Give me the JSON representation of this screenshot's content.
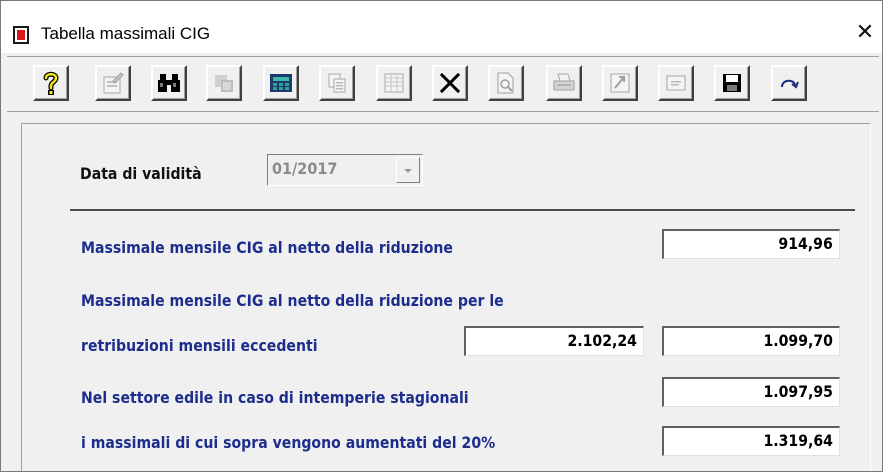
{
  "window": {
    "title": "Tabella massimali CIG",
    "close_glyph": "✕"
  },
  "toolbar": {
    "buttons": [
      {
        "icon": "help-icon",
        "enabled": true
      },
      {
        "icon": "properties-icon",
        "enabled": false
      },
      {
        "icon": "binoculars-icon",
        "enabled": true
      },
      {
        "icon": "copy-record-icon",
        "enabled": false
      },
      {
        "icon": "calculator-icon",
        "enabled": true
      },
      {
        "icon": "duplicate-icon",
        "enabled": false
      },
      {
        "icon": "grid-icon",
        "enabled": false
      },
      {
        "icon": "delete-icon",
        "enabled": true
      },
      {
        "icon": "preview-icon",
        "enabled": false
      },
      {
        "icon": "print-icon",
        "enabled": false
      },
      {
        "icon": "export-icon",
        "enabled": false
      },
      {
        "icon": "form-icon",
        "enabled": false
      },
      {
        "icon": "save-icon",
        "enabled": true
      },
      {
        "icon": "undo-icon",
        "enabled": true
      }
    ]
  },
  "form": {
    "validity_label": "Data di validità",
    "validity_value": "01/2017",
    "row1_label": "Massimale mensile CIG al netto della riduzione",
    "row1_value": "914,96",
    "row2_label_line1": "Massimale mensile CIG al netto della riduzione per le",
    "row2_label_line2": "retribuzioni mensili eccedenti",
    "row2_threshold": "2.102,24",
    "row2_value": "1.099,70",
    "row3_label": "Nel settore edile in caso di intemperie stagionali",
    "row3_value": "1.097,95",
    "row4_label": "i massimali di cui sopra vengono aumentati del 20%",
    "row4_value": "1.319,64"
  },
  "colors": {
    "label_blue": "#1d2d8c",
    "window_bg": "#f0f0f0",
    "titlebar_bg": "#ffffff",
    "app_icon_red": "#d9181c"
  }
}
